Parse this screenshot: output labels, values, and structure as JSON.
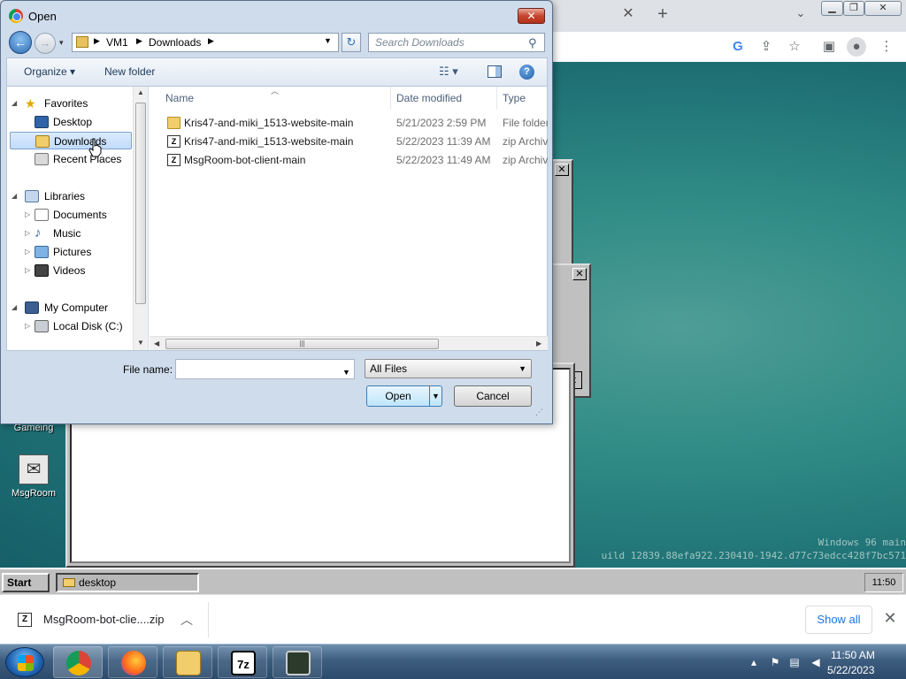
{
  "browser": {
    "tab_close": "✕",
    "new_tab": "+",
    "tab_search": "⌄",
    "toolbar_icons": [
      "google-icon",
      "share-icon",
      "star-icon",
      "side-panel-icon",
      "profile-icon",
      "menu-icon"
    ]
  },
  "w96": {
    "desktop_icons": [
      {
        "label": "Gameing"
      },
      {
        "label": "MsgRoom"
      }
    ],
    "watermark_line1": "Windows 96 main",
    "watermark_line2": "uild 12839.88efa922.230410-1942.d77c73edcc428f7bc571",
    "taskbar": {
      "start_label": "Start",
      "task_label": "desktop",
      "clock": "11:50"
    },
    "bg_window_button": "t"
  },
  "download_bar": {
    "file_name": "MsgRoom-bot-clie....zip",
    "show_all": "Show all"
  },
  "win7_taskbar": {
    "pinned": [
      "chrome",
      "firefox",
      "explorer",
      "7zip",
      "msgroom"
    ],
    "pin_7z_label": "7z",
    "time": "11:50 AM",
    "date": "5/22/2023"
  },
  "dialog": {
    "title": "Open",
    "close": "✕",
    "breadcrumbs": [
      "VM1",
      "Downloads"
    ],
    "search_placeholder": "Search Downloads",
    "organize": "Organize ▾",
    "new_folder": "New folder",
    "help": "?",
    "nav": {
      "favorites": "Favorites",
      "desktop": "Desktop",
      "downloads": "Downloads",
      "recent": "Recent Places",
      "libraries": "Libraries",
      "documents": "Documents",
      "music": "Music",
      "pictures": "Pictures",
      "videos": "Videos",
      "my_computer": "My Computer",
      "local_disk": "Local Disk (C:)"
    },
    "columns": {
      "name": "Name",
      "date": "Date modified",
      "type": "Type"
    },
    "files": [
      {
        "name": "Kris47-and-miki_1513-website-main",
        "date": "5/21/2023 2:59 PM",
        "type": "File folder",
        "icon": "folder-icon"
      },
      {
        "name": "Kris47-and-miki_1513-website-main",
        "date": "5/22/2023 11:39 AM",
        "type": "zip Archive",
        "icon": "zip-icon"
      },
      {
        "name": "MsgRoom-bot-client-main",
        "date": "5/22/2023 11:49 AM",
        "type": "zip Archive",
        "icon": "zip-icon"
      }
    ],
    "file_name_label": "File name:",
    "file_name_value": "",
    "file_type": "All Files",
    "open_button": "Open",
    "cancel_button": "Cancel"
  }
}
